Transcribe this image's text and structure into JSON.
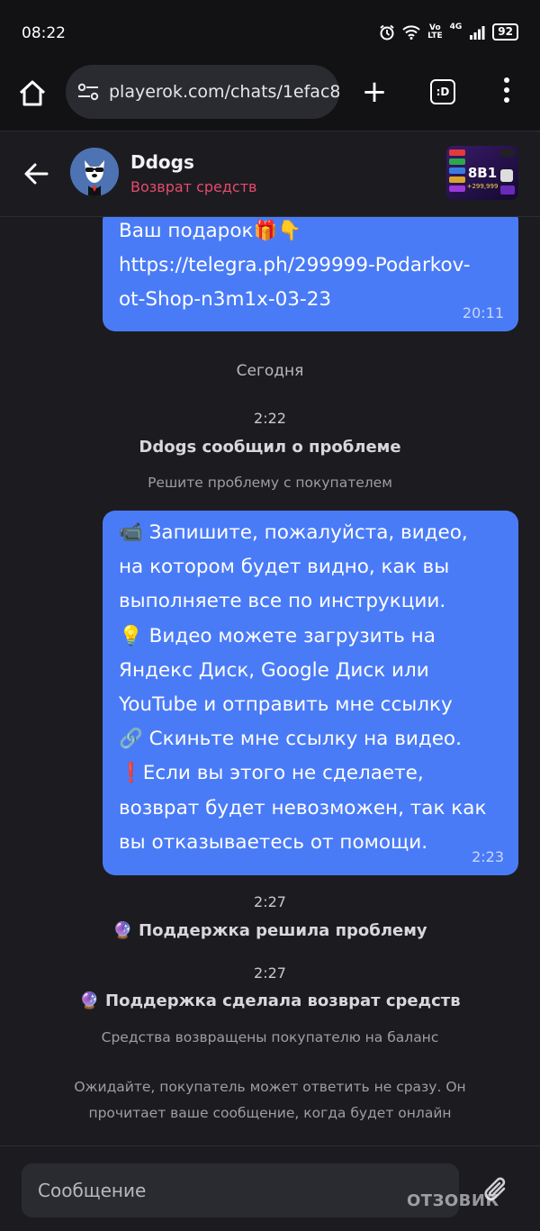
{
  "status_bar": {
    "time": "08:22",
    "network_label_top": "Vo",
    "network_label_bottom": "LTE",
    "cell_label": "4G",
    "battery": "92",
    "icons": [
      "alarm-icon",
      "wifi-icon",
      "signal-icon",
      "battery-icon"
    ]
  },
  "browser": {
    "url": "playerok.com/chats/1efac8",
    "tabs_label": ":D",
    "icons": [
      "home-icon",
      "site-settings-icon",
      "plus-icon",
      "tabs-icon",
      "more-vert-icon"
    ]
  },
  "chat_header": {
    "name": "Ddogs",
    "subtitle": "Возврат средств",
    "thumb_title": "8B1",
    "thumb_price": "+299,999",
    "accent_color": "#e64a6f"
  },
  "messages": {
    "first_bubble": {
      "lines": [
        "Ваш подарок🎁👇",
        "https://telegra.ph/299999-Podarkov-",
        "ot-Shop-n3m1x-03-23"
      ],
      "time": "20:11"
    },
    "date_separator": "Сегодня",
    "event1": {
      "time": "2:22",
      "title": "Ddogs сообщил о проблеме",
      "subtitle": "Решите проблему с покупателем"
    },
    "second_bubble": {
      "lines": [
        "📹 Запишите, пожалуйста, видео,",
        "на котором будет видно, как вы",
        "выполняете все по инструкции.",
        "💡 Видео можете загрузить на",
        "Яндекс Диск, Google Диск или",
        "YouTube и отправить мне ссылку",
        "🔗 Скиньте мне ссылку на видео.",
        "❗Если вы этого не сделаете,",
        "возврат будет невозможен, так как",
        "вы отказываетесь от помощи."
      ],
      "time": "2:23"
    },
    "event2": {
      "time": "2:27",
      "title": "🔮 Поддержка решила проблему"
    },
    "event3": {
      "time": "2:27",
      "title": "🔮 Поддержка сделала возврат средств",
      "subtitle": "Средства возвращены покупателю на баланс"
    },
    "notice_lines": [
      "Ожидайте, покупатель может ответить не сразу. Он",
      "прочитает ваше сообщение, когда будет онлайн"
    ],
    "bubble_color": "#4a7bf7"
  },
  "composer": {
    "placeholder": "Сообщение",
    "attach_icon": "paperclip-icon"
  },
  "watermark": "ОТЗОВИК"
}
